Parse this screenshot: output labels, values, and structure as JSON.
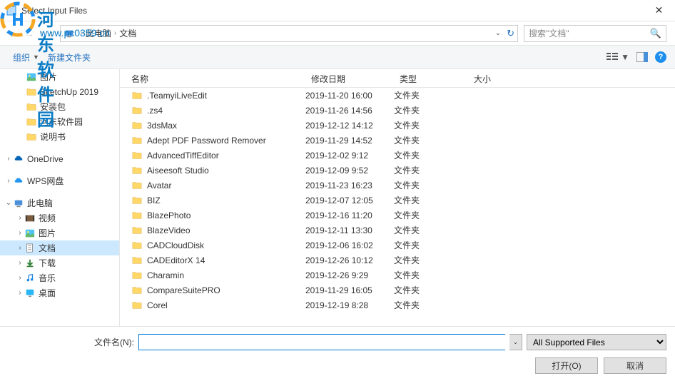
{
  "watermark": {
    "text1": "河东软件园",
    "text2": "www.pc0359.cn"
  },
  "titlebar": {
    "title": "Select Input Files"
  },
  "breadcrumb": {
    "segments": [
      "此电脑",
      "文档"
    ]
  },
  "search": {
    "placeholder": "搜索\"文档\""
  },
  "toolbar": {
    "organize": "组织",
    "newfolder": "新建文件夹"
  },
  "sidebar": {
    "items": [
      {
        "label": "图片",
        "icon": "pic",
        "indent": 2
      },
      {
        "label": "SketchUp 2019",
        "icon": "folder",
        "indent": 2
      },
      {
        "label": "安装包",
        "icon": "folder",
        "indent": 2
      },
      {
        "label": "河东软件园",
        "icon": "folder",
        "indent": 2
      },
      {
        "label": "说明书",
        "icon": "folder",
        "indent": 2
      }
    ],
    "onedrive": "OneDrive",
    "wps": "WPS网盘",
    "thispc": "此电脑",
    "pcitems": [
      {
        "label": "视频",
        "icon": "video"
      },
      {
        "label": "图片",
        "icon": "pic"
      },
      {
        "label": "文档",
        "icon": "doc",
        "selected": true
      },
      {
        "label": "下载",
        "icon": "download"
      },
      {
        "label": "音乐",
        "icon": "music"
      },
      {
        "label": "桌面",
        "icon": "desktop"
      }
    ]
  },
  "columns": {
    "name": "名称",
    "date": "修改日期",
    "type": "类型",
    "size": "大小"
  },
  "files": [
    {
      "name": ".TeamyiLiveEdit",
      "date": "2019-11-20 16:00",
      "type": "文件夹"
    },
    {
      "name": ".zs4",
      "date": "2019-11-26 14:56",
      "type": "文件夹"
    },
    {
      "name": "3dsMax",
      "date": "2019-12-12 14:12",
      "type": "文件夹"
    },
    {
      "name": "Adept PDF Password Remover",
      "date": "2019-11-29 14:52",
      "type": "文件夹"
    },
    {
      "name": "AdvancedTiffEditor",
      "date": "2019-12-02 9:12",
      "type": "文件夹"
    },
    {
      "name": "Aiseesoft Studio",
      "date": "2019-12-09 9:52",
      "type": "文件夹"
    },
    {
      "name": "Avatar",
      "date": "2019-11-23 16:23",
      "type": "文件夹"
    },
    {
      "name": "BIZ",
      "date": "2019-12-07 12:05",
      "type": "文件夹"
    },
    {
      "name": "BlazePhoto",
      "date": "2019-12-16 11:20",
      "type": "文件夹"
    },
    {
      "name": "BlazeVideo",
      "date": "2019-12-11 13:30",
      "type": "文件夹"
    },
    {
      "name": "CADCloudDisk",
      "date": "2019-12-06 16:02",
      "type": "文件夹"
    },
    {
      "name": "CADEditorX 14",
      "date": "2019-12-26 10:12",
      "type": "文件夹"
    },
    {
      "name": "Charamin",
      "date": "2019-12-26 9:29",
      "type": "文件夹"
    },
    {
      "name": "CompareSuitePRO",
      "date": "2019-11-29 16:05",
      "type": "文件夹"
    },
    {
      "name": "Corel",
      "date": "2019-12-19 8:28",
      "type": "文件夹"
    }
  ],
  "bottom": {
    "filename_label": "文件名(N):",
    "filter": "All Supported Files",
    "open": "打开(O)",
    "cancel": "取消"
  }
}
